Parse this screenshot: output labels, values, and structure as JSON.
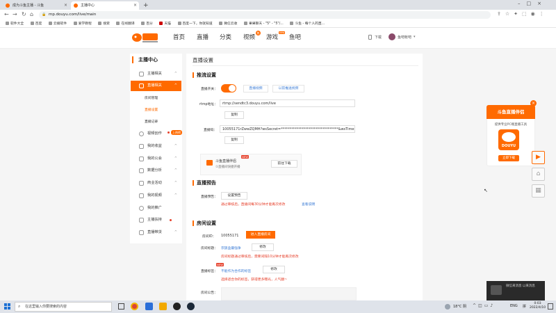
{
  "browser": {
    "tabs": [
      {
        "title": "成为斗鱼主播 - 斗鱼"
      },
      {
        "title": "主播中心"
      }
    ],
    "url": "mp.douyu.com/live/main",
    "new_tab": "+"
  },
  "bookmarks": [
    "软件大全",
    "百度",
    "云播软件",
    "爱学教程",
    "搜索",
    "在线翻译",
    "百分",
    "天猫",
    "百度一下，你就知道",
    "微信云收",
    "果果聊天 - \"5\" - \"5\"/...",
    "斗鱼 - 每个人的直..."
  ],
  "header": {
    "menu": [
      "首页",
      "直播",
      "分类",
      "视频",
      "游戏",
      "鱼吧"
    ],
    "video_badge": "热",
    "game_badge": "new",
    "download": "下载",
    "username": "鱼吧帐吧"
  },
  "sidebar": {
    "title": "主播中心",
    "items": [
      {
        "label": "主播相关"
      },
      {
        "label": "直播相关"
      },
      {
        "label": "视频创作",
        "badge": "上热榜"
      },
      {
        "label": "我的收益"
      },
      {
        "label": "我的公会"
      },
      {
        "label": "数据分析"
      },
      {
        "label": "商业活动"
      },
      {
        "label": "我的视频"
      },
      {
        "label": "我的推广"
      },
      {
        "label": "主播扶持"
      },
      {
        "label": "直播带货"
      }
    ],
    "subitems": [
      "房间管理",
      "直播设置",
      "直播记录"
    ]
  },
  "page": {
    "title": "直播设置",
    "stream": {
      "title": "推流设置",
      "switch_label": "直播开关：",
      "btn_record": "直播视频",
      "btn_check": "以前推送视频",
      "rtmp_label": "rtmp地址：",
      "rtmp_value": "rtmp://sendtc3.douyu.com/live",
      "copy1": "复制",
      "code_label": "直播码：",
      "code_value": "10055171rZwwZQMH?wsSecret=*********************************&wsTime=",
      "copy2": "复制",
      "companion_name": "斗鱼直播伴侣",
      "companion_sub": "①直播间快捷开播",
      "companion_new": "NEW",
      "companion_btn": "前往下载"
    },
    "preview": {
      "title": "直播预告",
      "label": "直播预告：",
      "btn": "设置预告",
      "note": "通过审核后，直播间每30分钟才能再次修改",
      "link": "查看说明"
    },
    "room": {
      "title": "房间设置",
      "id_label": "房间ID：",
      "id_value": "10055171",
      "enter_btn": "进入直播房间",
      "name_label": "房间标题：",
      "name_value": "宗族盒最强争",
      "edit1": "修改",
      "name_note": "房间标题通过审核后，需要间隔10分钟才能再次修改",
      "tag_label": "直播标签：",
      "tag_value": "不能作为合作的标签",
      "tag_new": "NEW",
      "edit2": "修改",
      "tag_note": "选择适合你的标签，获得更多曝光，人气翻~",
      "notice_label": "房间公告："
    }
  },
  "promo": {
    "title": "斗鱼直播伴侣",
    "desc": "提供专业PC端直播工具",
    "logo_text": "DOUYU",
    "btn": "立即下载"
  },
  "notification": {
    "text": "微信来消息 以来消息"
  },
  "taskbar": {
    "search": "在这里输入你要搜索的内容",
    "temp": "18°C 阴",
    "lang": "ENG",
    "time": "0:03",
    "date": "2022/4/10"
  },
  "colors": {
    "accent": "#ff6a00",
    "link": "#3a7bd5",
    "warn": "#e6402b"
  }
}
